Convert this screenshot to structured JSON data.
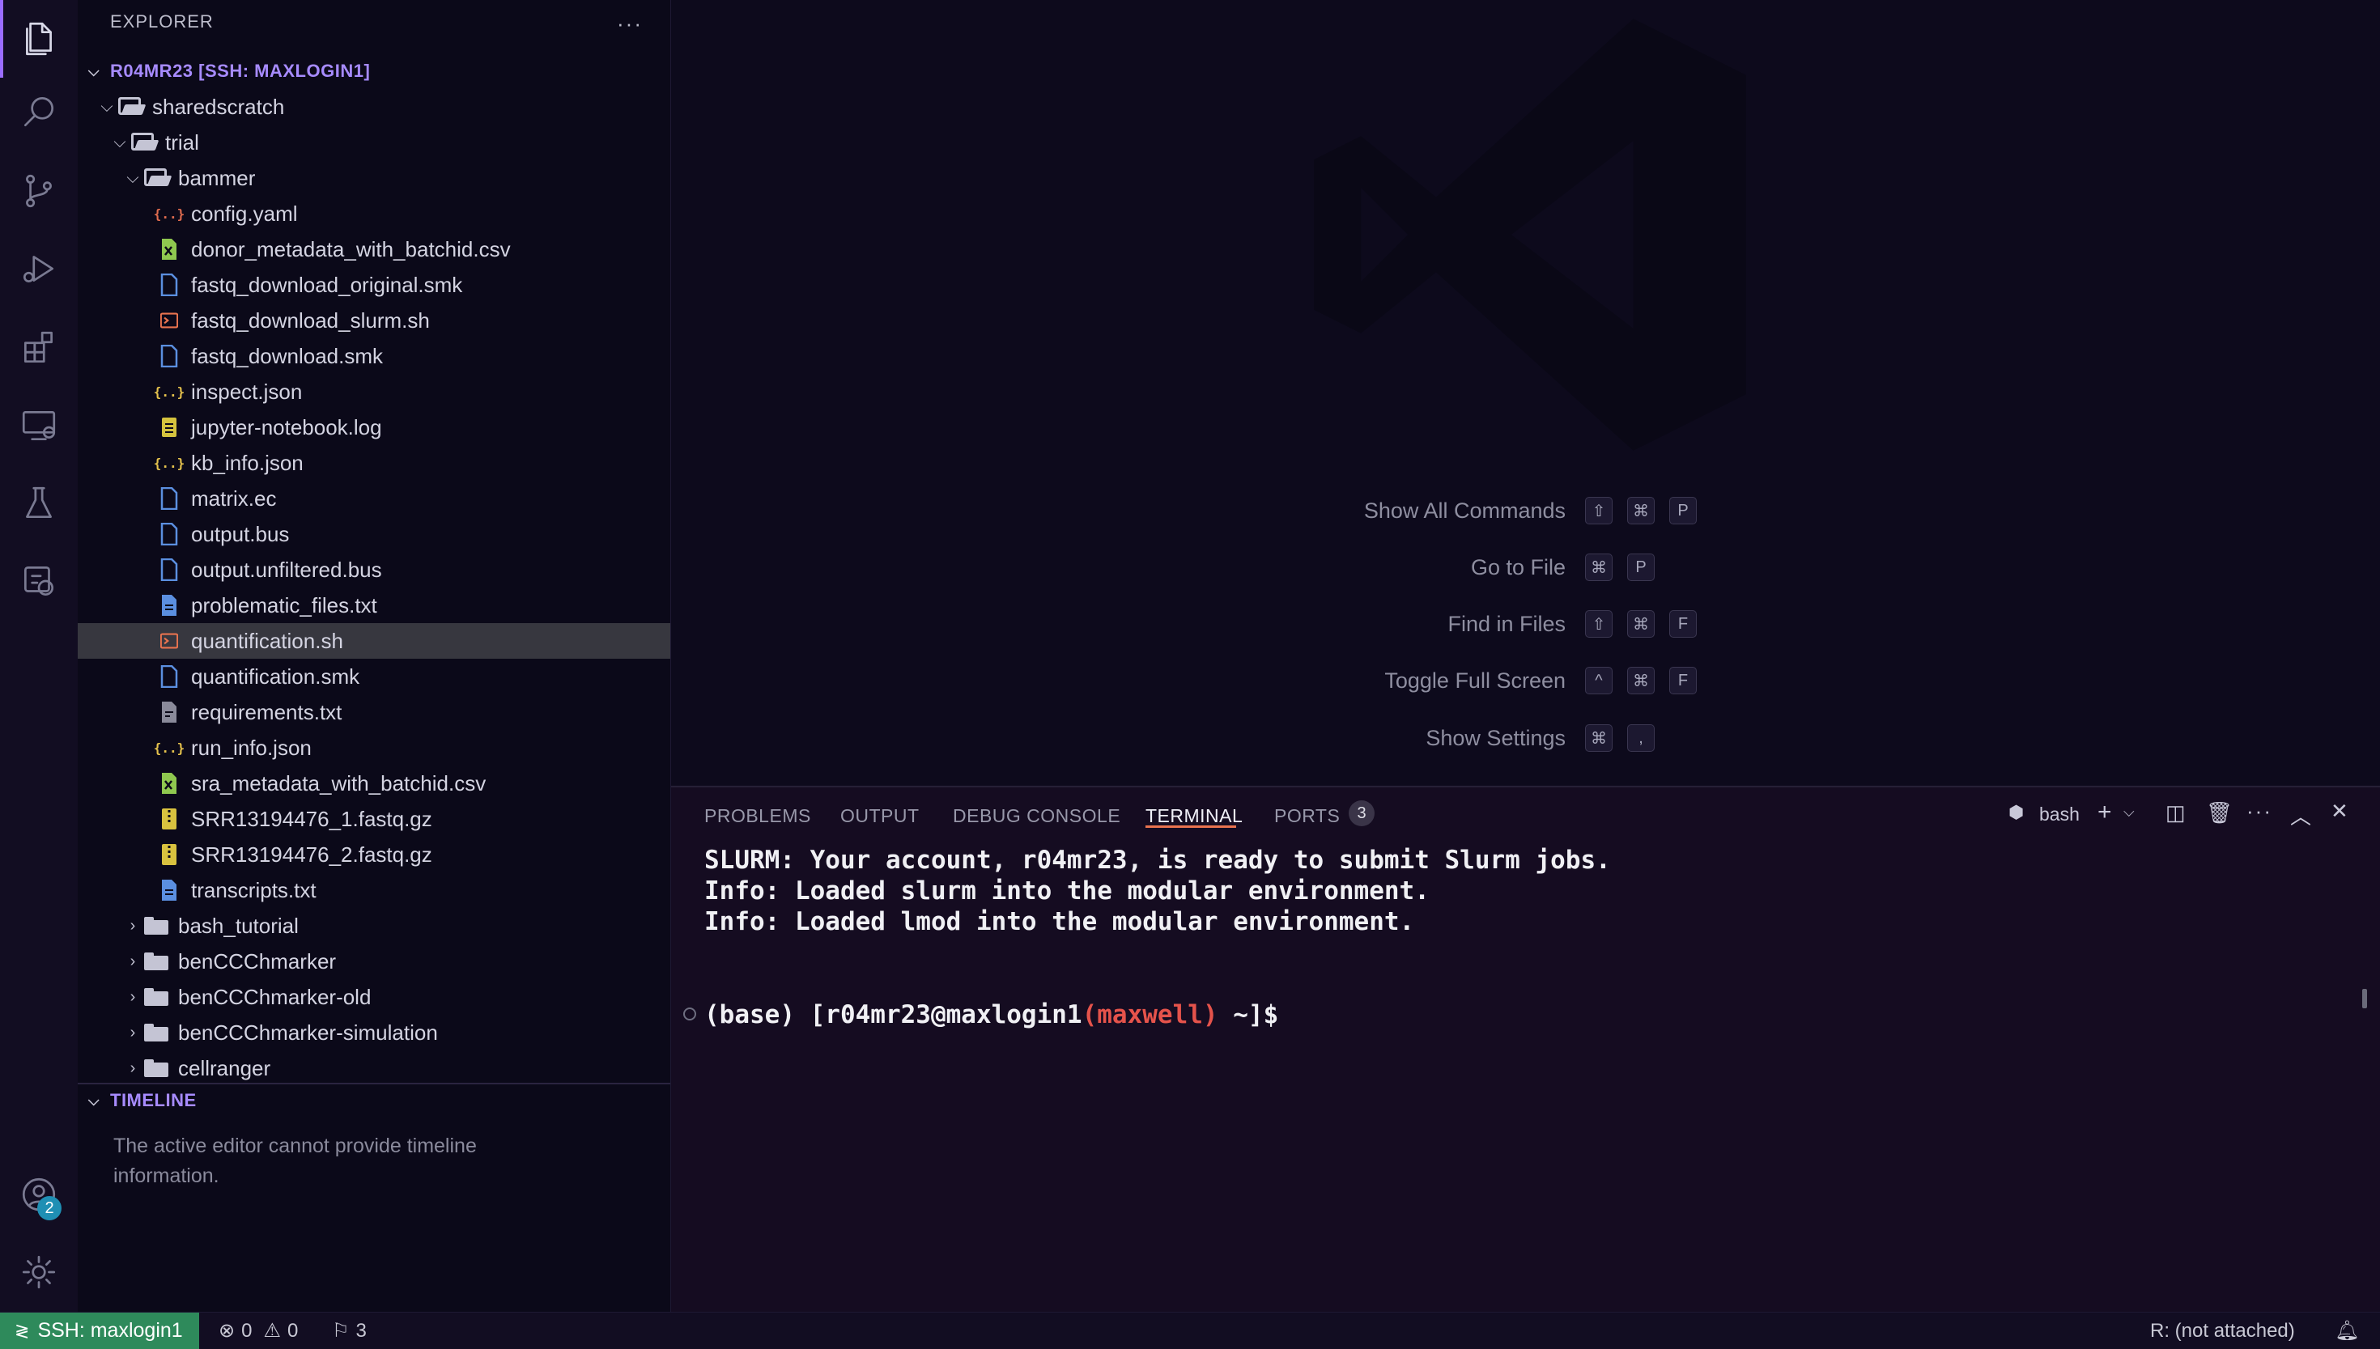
{
  "activity_bar": {
    "items": [
      {
        "name": "explorer",
        "icon": "files-icon",
        "active": true
      },
      {
        "name": "search",
        "icon": "search-icon"
      },
      {
        "name": "source-control",
        "icon": "source-control-icon"
      },
      {
        "name": "run-debug",
        "icon": "run-debug-icon"
      },
      {
        "name": "extensions",
        "icon": "extensions-icon"
      },
      {
        "name": "remote-explorer",
        "icon": "remote-explorer-icon"
      },
      {
        "name": "testing",
        "icon": "flask-icon"
      },
      {
        "name": "kubernetes",
        "icon": "remote-tunnel-icon"
      }
    ],
    "accounts_badge": "2"
  },
  "sidebar": {
    "title": "EXPLORER",
    "workspace_title": "R04MR23 [SSH: MAXLOGIN1]",
    "tree": [
      {
        "label": "sharedscratch",
        "type": "folder-open",
        "depth": 0
      },
      {
        "label": "trial",
        "type": "folder-open",
        "depth": 1
      },
      {
        "label": "bammer",
        "type": "folder-open",
        "depth": 2
      },
      {
        "label": "config.yaml",
        "type": "yaml",
        "glyph": "{..}",
        "depth": 3
      },
      {
        "label": "donor_metadata_with_batchid.csv",
        "type": "csv",
        "depth": 3
      },
      {
        "label": "fastq_download_original.smk",
        "type": "doc",
        "depth": 3
      },
      {
        "label": "fastq_download_slurm.sh",
        "type": "sh",
        "depth": 3
      },
      {
        "label": "fastq_download.smk",
        "type": "doc",
        "depth": 3
      },
      {
        "label": "inspect.json",
        "type": "json",
        "glyph": "{..}",
        "depth": 3
      },
      {
        "label": "jupyter-notebook.log",
        "type": "log",
        "depth": 3
      },
      {
        "label": "kb_info.json",
        "type": "json",
        "glyph": "{..}",
        "depth": 3
      },
      {
        "label": "matrix.ec",
        "type": "doc",
        "depth": 3
      },
      {
        "label": "output.bus",
        "type": "doc",
        "depth": 3
      },
      {
        "label": "output.unfiltered.bus",
        "type": "doc",
        "depth": 3
      },
      {
        "label": "problematic_files.txt",
        "type": "txt",
        "depth": 3
      },
      {
        "label": "quantification.sh",
        "type": "sh",
        "depth": 3,
        "selected": true
      },
      {
        "label": "quantification.smk",
        "type": "doc",
        "depth": 3
      },
      {
        "label": "requirements.txt",
        "type": "req",
        "depth": 3
      },
      {
        "label": "run_info.json",
        "type": "json",
        "glyph": "{..}",
        "depth": 3
      },
      {
        "label": "sra_metadata_with_batchid.csv",
        "type": "csv",
        "depth": 3
      },
      {
        "label": "SRR13194476_1.fastq.gz",
        "type": "gz",
        "depth": 3
      },
      {
        "label": "SRR13194476_2.fastq.gz",
        "type": "gz",
        "depth": 3
      },
      {
        "label": "transcripts.txt",
        "type": "txt",
        "depth": 3
      },
      {
        "label": "bash_tutorial",
        "type": "folder",
        "depth": 2
      },
      {
        "label": "benCCChmarker",
        "type": "folder",
        "depth": 2
      },
      {
        "label": "benCCChmarker-old",
        "type": "folder",
        "depth": 2
      },
      {
        "label": "benCCChmarker-simulation",
        "type": "folder",
        "depth": 2
      },
      {
        "label": "cellranger",
        "type": "folder",
        "depth": 2
      }
    ],
    "timeline_title": "TIMELINE",
    "timeline_message": "The active editor cannot provide timeline information."
  },
  "editor": {
    "watermark_icon": "vscode-logo-icon",
    "shortcuts": [
      {
        "label": "Show All Commands",
        "keys": [
          "⇧",
          "⌘",
          "P"
        ]
      },
      {
        "label": "Go to File",
        "keys": [
          "⌘",
          "P"
        ]
      },
      {
        "label": "Find in Files",
        "keys": [
          "⇧",
          "⌘",
          "F"
        ]
      },
      {
        "label": "Toggle Full Screen",
        "keys": [
          "^",
          "⌘",
          "F"
        ]
      },
      {
        "label": "Show Settings",
        "keys": [
          "⌘",
          ","
        ]
      }
    ]
  },
  "panel": {
    "tabs": [
      "PROBLEMS",
      "OUTPUT",
      "DEBUG CONSOLE",
      "TERMINAL",
      "PORTS"
    ],
    "active_tab": "TERMINAL",
    "ports_count": "3",
    "shell_label": "bash",
    "terminal_lines": [
      "SLURM: Your account, r04mr23, is ready to submit Slurm jobs.",
      "Info: Loaded slurm into the modular environment.",
      "Info: Loaded lmod into the modular environment."
    ],
    "prompt": {
      "prefix": "(base) [r04mr23@maxlogin1",
      "host": "(maxwell)",
      "suffix": " ~]$"
    }
  },
  "status_bar": {
    "remote": "SSH: maxlogin1",
    "errors": "0",
    "warnings": "0",
    "ports": "3",
    "r_status": "R: (not attached)"
  },
  "colors": {
    "accent": "#9a6cff",
    "remote_bg": "#2e8a5b",
    "terminal_tab_underline": "#e8734f",
    "host_red": "#e5534b"
  }
}
